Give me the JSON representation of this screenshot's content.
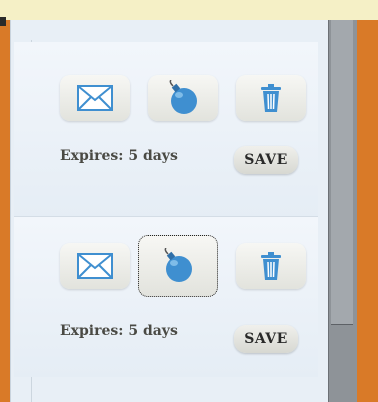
{
  "cards": [
    {
      "actions": {
        "email_icon": "envelope-icon",
        "burn_icon": "bomb-icon",
        "delete_icon": "trash-icon"
      },
      "expires_label": "Expires: 5 days",
      "save_label": "SAVE"
    },
    {
      "actions": {
        "email_icon": "envelope-icon",
        "burn_icon": "bomb-icon",
        "delete_icon": "trash-icon"
      },
      "expires_label": "Expires: 5 days",
      "save_label": "SAVE",
      "focused_action": "bomb"
    }
  ],
  "colors": {
    "background": "#d97a28",
    "panel": "#e8eff6",
    "icon_blue": "#3f8fd0",
    "scrollbar": "#8e9398"
  }
}
